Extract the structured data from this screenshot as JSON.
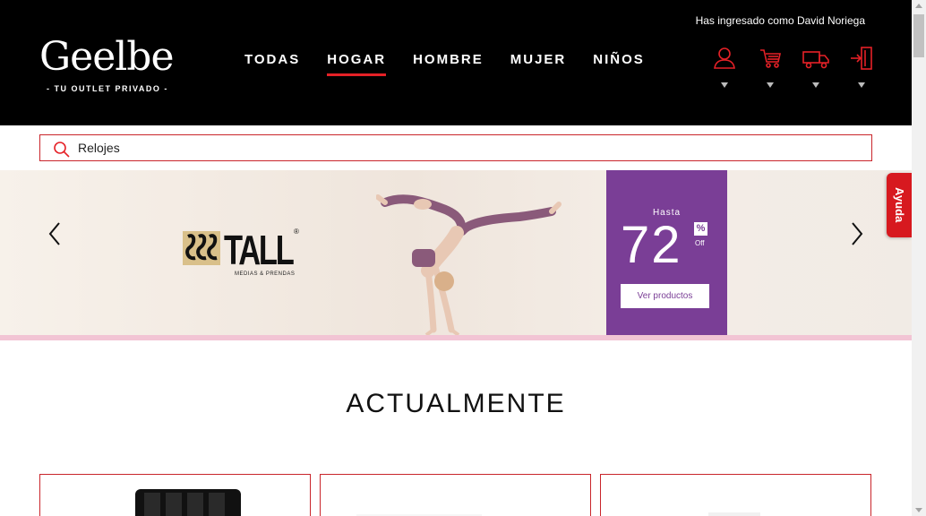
{
  "logo": {
    "word": "Geelbe",
    "tagline": "- TU OUTLET PRIVADO -"
  },
  "nav": {
    "items": [
      {
        "label": "TODAS",
        "active": false
      },
      {
        "label": "HOGAR",
        "active": true
      },
      {
        "label": "HOMBRE",
        "active": false
      },
      {
        "label": "MUJER",
        "active": false
      },
      {
        "label": "NIÑOS",
        "active": false
      }
    ]
  },
  "user": {
    "greeting": "Has ingresado como David Noriega"
  },
  "header_icons": [
    "user-icon",
    "cart-icon",
    "truck-icon",
    "logout-icon"
  ],
  "search": {
    "value": "Relojes",
    "placeholder": ""
  },
  "banner": {
    "brand_name": "TALL",
    "brand_reg": "®",
    "brand_subtitle": "MEDIAS & PRENDAS",
    "promo_prefix": "Hasta",
    "promo_number": "72",
    "promo_percent": "%",
    "promo_off": "Off",
    "promo_button": "Ver productos"
  },
  "help": {
    "label": "Ayuda"
  },
  "section": {
    "title": "ACTUALMENTE"
  },
  "colors": {
    "accent": "#c9252b",
    "header_bg": "#000000",
    "promo_bg": "#7a3e96",
    "help_bg": "#d7191f"
  }
}
